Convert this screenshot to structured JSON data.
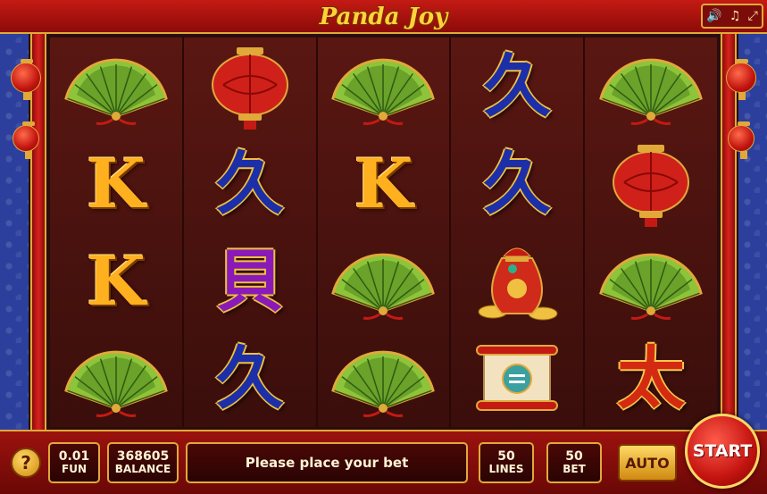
{
  "title": "Panda Joy",
  "system_icons": [
    "speaker-icon",
    "music-note-icon",
    "fullscreen-icon"
  ],
  "reels": [
    [
      "fan",
      "char-gold",
      "char-gold",
      "fan"
    ],
    [
      "lantern",
      "char-blue",
      "char-purple",
      "char-blue"
    ],
    [
      "fan",
      "char-gold",
      "fan",
      "fan"
    ],
    [
      "char-blue",
      "char-blue",
      "money-bag",
      "scroll"
    ],
    [
      "fan",
      "lantern",
      "fan",
      "char-red"
    ]
  ],
  "symbol_glyphs": {
    "char-gold": "K",
    "char-blue": "久",
    "char-purple": "貝",
    "char-red": "太"
  },
  "bottom": {
    "help_label": "?",
    "fun_value": "0.01",
    "fun_label": "FUN",
    "balance_value": "368605",
    "balance_label": "BALANCE",
    "message": "Please place your bet",
    "lines_value": "50",
    "lines_label": "LINES",
    "bet_value": "50",
    "bet_label": "BET",
    "auto_label": "AUTO",
    "start_label": "START"
  },
  "colors": {
    "frame_red": "#c41a14",
    "gold": "#e0a93a",
    "side_blue": "#2c3f9c",
    "reel_bg": "#4a1410"
  }
}
